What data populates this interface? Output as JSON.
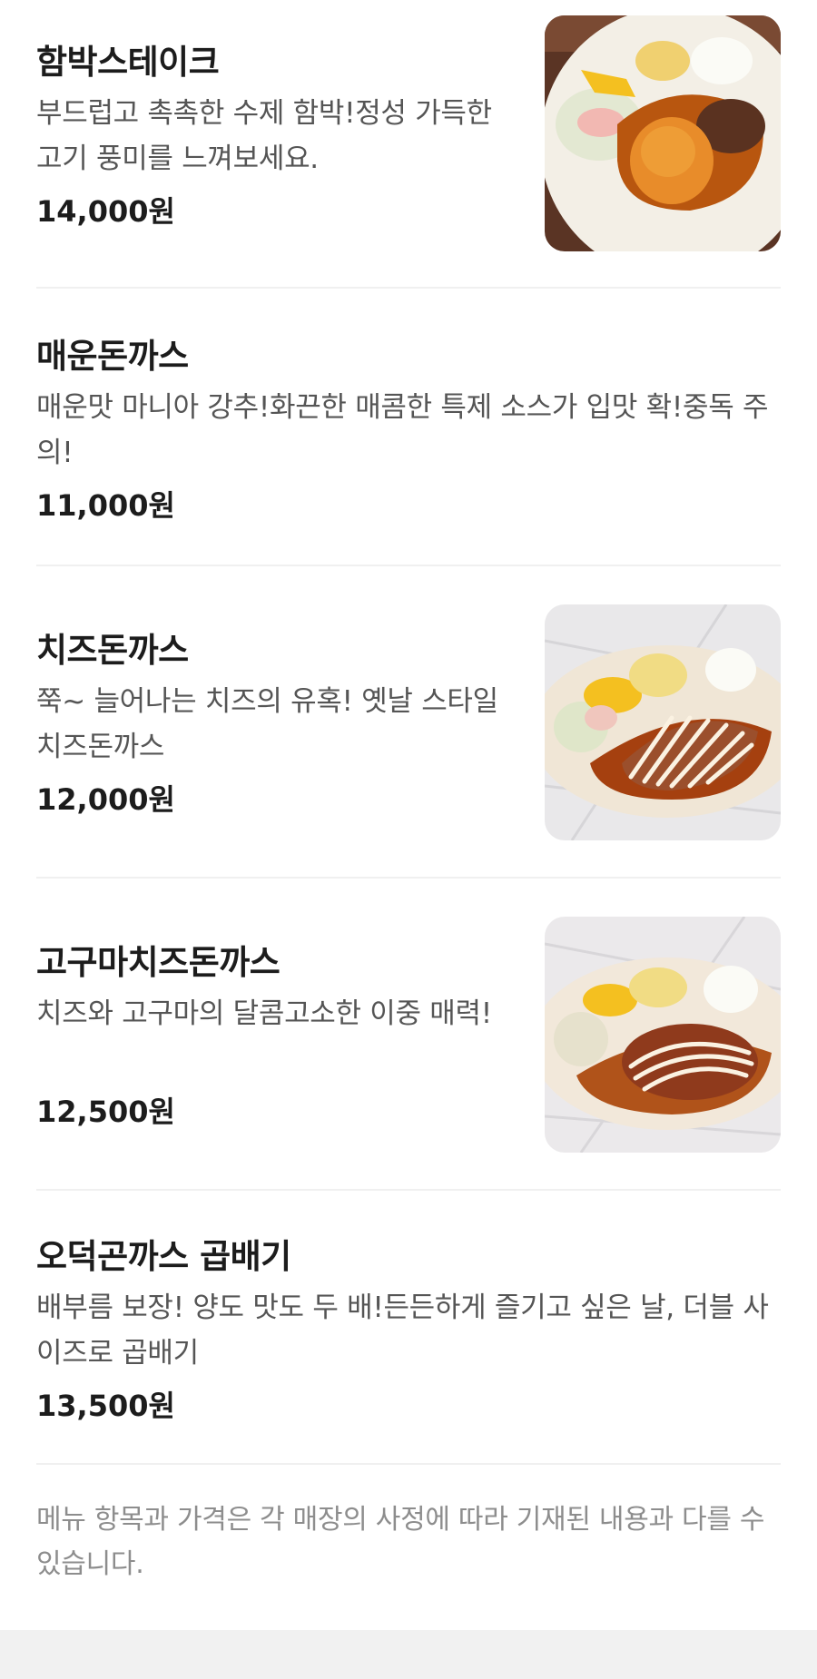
{
  "menu": {
    "items": [
      {
        "name": "함박스테이크",
        "description": "부드럽고 촉촉한 수제 함박!정성 가득한 고기 풍미를 느껴보세요.",
        "price": "14,000원",
        "photo_icon": "hamburg-steak-plate-photo"
      },
      {
        "name": "매운돈까스",
        "description": "매운맛 마니아 강추!화끈한 매콤한 특제 소스가 입맛 확!중독 주의!",
        "price": "11,000원"
      },
      {
        "name": "치즈돈까스",
        "description": "쭉~ 늘어나는 치즈의 유혹! 옛날 스타일 치즈돈까스",
        "price": "12,000원",
        "photo_icon": "cheese-donkatsu-plate-photo"
      },
      {
        "name": "고구마치즈돈까스",
        "description": "치즈와 고구마의 달콤고소한 이중 매력!",
        "price": "12,500원",
        "photo_icon": "sweet-potato-cheese-donkatsu-plate-photo"
      },
      {
        "name": "오덕곤까스 곱배기",
        "description": "배부름 보장! 양도 맛도 두 배!든든하게 즐기고 싶은 날, 더블 사이즈로 곱배기",
        "price": "13,500원"
      }
    ]
  },
  "notice": {
    "text": "메뉴 항목과 가격은 각 매장의 사정에 따라 기재된 내용과 다를 수 있습니다."
  },
  "colors": {
    "title": "#1c1c1c",
    "description": "#555555",
    "notice": "#8d8d8d",
    "divider": "#f0f0f0",
    "bottom_band": "#f1f1f1"
  }
}
